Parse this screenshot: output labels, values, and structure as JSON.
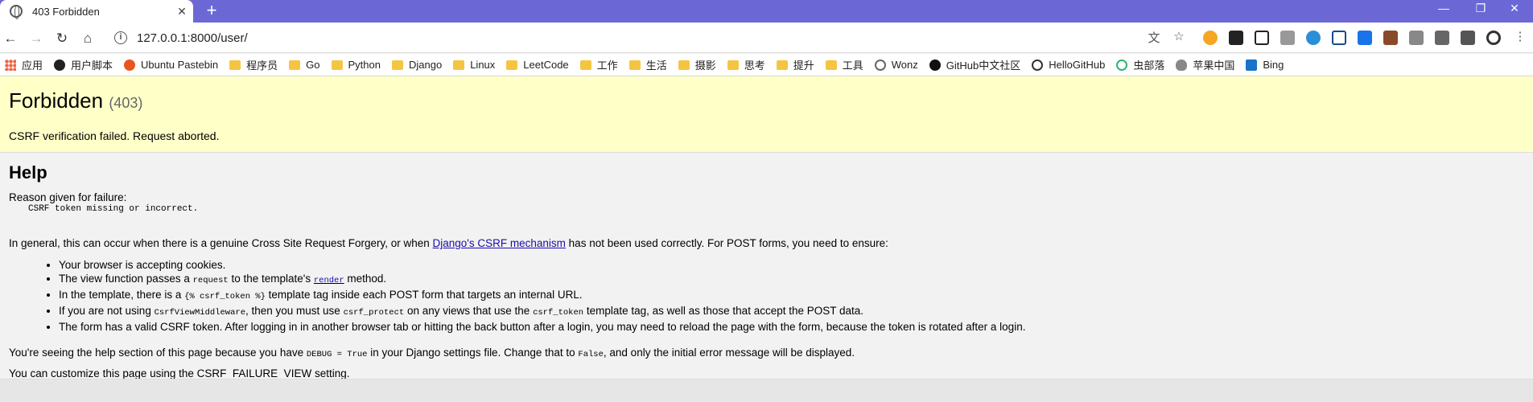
{
  "tab": {
    "title": "403 Forbidden"
  },
  "toolbar": {
    "url": "127.0.0.1:8000/user/"
  },
  "bookmarks": [
    {
      "label": "应用",
      "icon": "apps-icon",
      "cls": "apps"
    },
    {
      "label": "用户脚本",
      "icon": "userscript-icon",
      "cls": "dark"
    },
    {
      "label": "Ubuntu Pastebin",
      "icon": "ubuntu-icon",
      "cls": "ubuntu"
    },
    {
      "label": "程序员",
      "icon": "folder-icon",
      "cls": "folder"
    },
    {
      "label": "Go",
      "icon": "folder-icon",
      "cls": "folder"
    },
    {
      "label": "Python",
      "icon": "folder-icon",
      "cls": "folder"
    },
    {
      "label": "Django",
      "icon": "folder-icon",
      "cls": "folder"
    },
    {
      "label": "Linux",
      "icon": "folder-icon",
      "cls": "folder"
    },
    {
      "label": "LeetCode",
      "icon": "folder-icon",
      "cls": "folder"
    },
    {
      "label": "工作",
      "icon": "folder-icon",
      "cls": "folder"
    },
    {
      "label": "生活",
      "icon": "folder-icon",
      "cls": "folder"
    },
    {
      "label": "摄影",
      "icon": "folder-icon",
      "cls": "folder"
    },
    {
      "label": "思考",
      "icon": "folder-icon",
      "cls": "folder"
    },
    {
      "label": "提升",
      "icon": "folder-icon",
      "cls": "folder"
    },
    {
      "label": "工具",
      "icon": "folder-icon",
      "cls": "folder"
    },
    {
      "label": "Wonz",
      "icon": "ring-icon",
      "cls": "ring"
    },
    {
      "label": "GitHub中文社区",
      "icon": "github-icon",
      "cls": "gh"
    },
    {
      "label": "HelloGitHub",
      "icon": "hellogithub-icon",
      "cls": "hello"
    },
    {
      "label": "虫部落",
      "icon": "chongbuluo-icon",
      "cls": "green"
    },
    {
      "label": "苹果中国",
      "icon": "apple-icon",
      "cls": "apple"
    },
    {
      "label": "Bing",
      "icon": "bing-icon",
      "cls": "bing"
    }
  ],
  "summary": {
    "title": "Forbidden",
    "code": "(403)",
    "message": "CSRF verification failed. Request aborted."
  },
  "help": {
    "heading": "Help",
    "reason_label": "Reason given for failure:",
    "reason": "CSRF token missing or incorrect.",
    "general_before": "In general, this can occur when there is a genuine Cross Site Request Forgery, or when ",
    "general_link": "Django's CSRF mechanism",
    "general_after": " has not been used correctly. For POST forms, you need to ensure:",
    "items": {
      "i1": "Your browser is accepting cookies.",
      "i2a": "The view function passes a ",
      "i2b": "request",
      "i2c": " to the template's ",
      "i2d": "render",
      "i2e": " method.",
      "i3a": "In the template, there is a ",
      "i3b": "{% csrf_token %}",
      "i3c": " template tag inside each POST form that targets an internal URL.",
      "i4a": "If you are not using ",
      "i4b": "CsrfViewMiddleware",
      "i4c": ", then you must use ",
      "i4d": "csrf_protect",
      "i4e": " on any views that use the ",
      "i4f": "csrf_token",
      "i4g": " template tag, as well as those that accept the POST data.",
      "i5": "The form has a valid CSRF token. After logging in in another browser tab or hitting the back button after a login, you may need to reload the page with the form, because the token is rotated after a login."
    },
    "debug_a": "You're seeing the help section of this page because you have ",
    "debug_b": "DEBUG = True",
    "debug_c": " in your Django settings file. Change that to ",
    "debug_d": "False",
    "debug_e": ", and only the initial error message will be displayed.",
    "custom": "You can customize this page using the CSRF_FAILURE_VIEW setting."
  }
}
